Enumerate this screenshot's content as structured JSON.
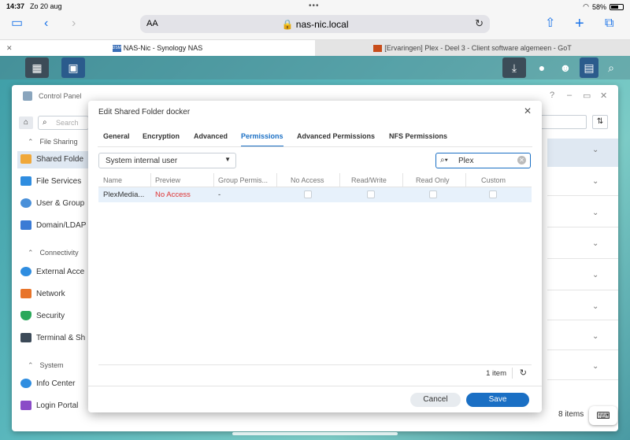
{
  "status": {
    "time": "14:37",
    "date": "Zo 20 aug",
    "battery": "58%"
  },
  "safari": {
    "aa": "AA",
    "url": "nas-nic.local"
  },
  "tabs": [
    {
      "label": "NAS-Nic - Synology NAS",
      "favicon": "DSM"
    },
    {
      "label": "[Ervaringen] Plex - Deel 3 - Client software algemeen - GoT"
    }
  ],
  "control_panel": {
    "title": "Control Panel",
    "search_placeholder": "Search",
    "sections": {
      "file_sharing": "File Sharing",
      "connectivity": "Connectivity",
      "system": "System"
    },
    "items": {
      "shared_folder": "Shared Folde",
      "file_services": "File Services",
      "user_group": "User & Group",
      "domain_ldap": "Domain/LDAP",
      "external_access": "External Acce",
      "network": "Network",
      "security": "Security",
      "terminal": "Terminal & Sh",
      "info_center": "Info Center",
      "login_portal": "Login Portal"
    },
    "items_count": "8 items"
  },
  "dialog": {
    "title": "Edit Shared Folder docker",
    "tabs": [
      "General",
      "Encryption",
      "Advanced",
      "Permissions",
      "Advanced Permissions",
      "NFS Permissions"
    ],
    "active_tab": "Permissions",
    "user_type": "System internal user",
    "search_value": "Plex",
    "columns": [
      "Name",
      "Preview",
      "Group Permis...",
      "No Access",
      "Read/Write",
      "Read Only",
      "Custom"
    ],
    "rows": [
      {
        "name": "PlexMedia...",
        "preview": "No Access",
        "group": "-",
        "no_access": false,
        "read_write": false,
        "read_only": false,
        "custom": false
      }
    ],
    "footer_count": "1 item",
    "cancel": "Cancel",
    "save": "Save"
  },
  "colors": {
    "accent": "#1a6fc4",
    "no_access": "#dd3333"
  }
}
